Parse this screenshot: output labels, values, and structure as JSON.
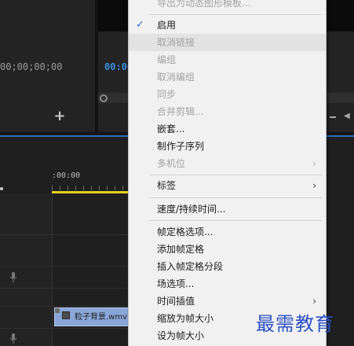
{
  "source_monitor": {
    "timecode": "00;00;00;00"
  },
  "program_monitor": {
    "timecode": "00:00"
  },
  "timeline": {
    "ruler_timecode": ":00:00",
    "clip_label": "粒子背景.wmv"
  },
  "context_menu": {
    "items": [
      {
        "label": "导出为动态图形模板...",
        "enabled": false
      },
      {
        "label": "启用",
        "enabled": true,
        "checked": true
      },
      {
        "label": "取消链接",
        "enabled": false,
        "highlighted": true
      },
      {
        "label": "编组",
        "enabled": false
      },
      {
        "label": "取消编组",
        "enabled": false
      },
      {
        "label": "同步",
        "enabled": false
      },
      {
        "label": "合并剪辑...",
        "enabled": false
      },
      {
        "label": "嵌套...",
        "enabled": true
      },
      {
        "label": "制作子序列",
        "enabled": true
      },
      {
        "label": "多机位",
        "enabled": false,
        "submenu": true
      },
      {
        "label": "标签",
        "enabled": true,
        "submenu": true
      },
      {
        "label": "速度/持续时间...",
        "enabled": true
      },
      {
        "label": "帧定格选项...",
        "enabled": true
      },
      {
        "label": "添加帧定格",
        "enabled": true
      },
      {
        "label": "插入帧定格分段",
        "enabled": true
      },
      {
        "label": "场选项...",
        "enabled": true
      },
      {
        "label": "时间插值",
        "enabled": true,
        "submenu": true
      },
      {
        "label": "缩放为帧大小",
        "enabled": true
      },
      {
        "label": "设为帧大小",
        "enabled": true
      }
    ],
    "submenu_arrow": "›",
    "check_mark": "✓"
  },
  "watermark": "最需教育",
  "colors": {
    "accent_blue": "#2d6fb8",
    "timecode_blue": "#3b8ee3",
    "playhead_yellow": "#e3d21a",
    "clip_blue": "#8aa6d8",
    "watermark_blue": "#2b50c4"
  }
}
